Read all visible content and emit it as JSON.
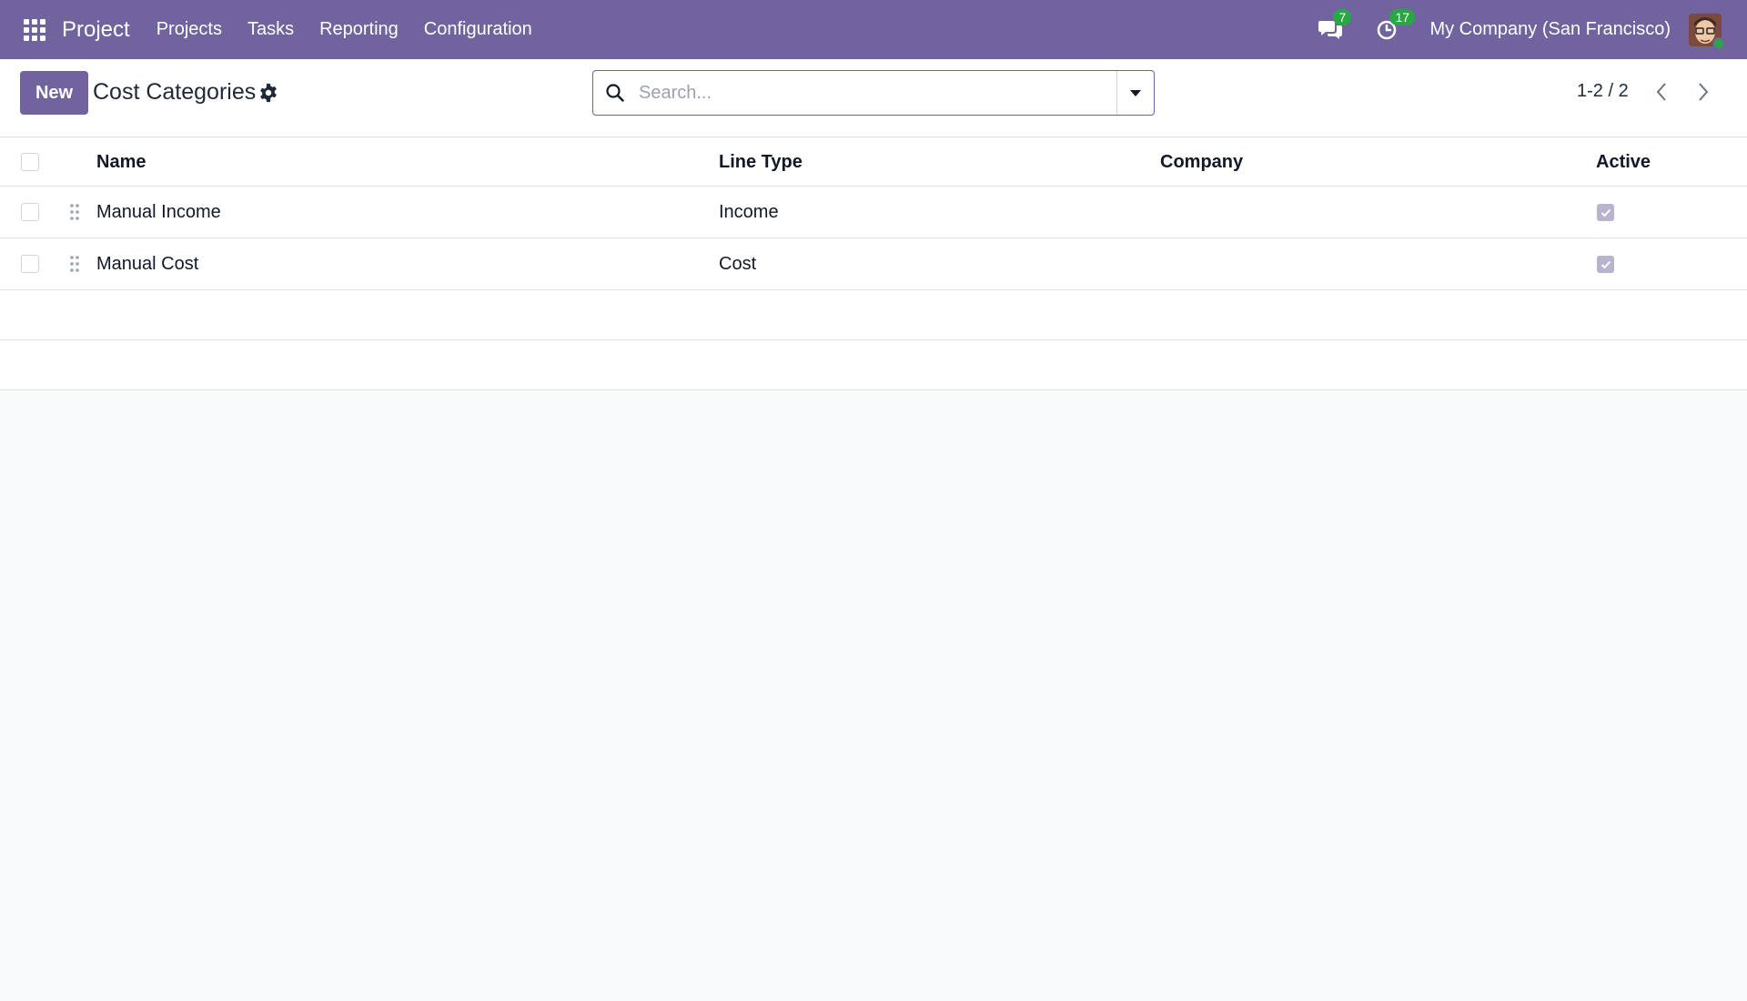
{
  "navbar": {
    "app_name": "Project",
    "menu": [
      "Projects",
      "Tasks",
      "Reporting",
      "Configuration"
    ],
    "messages_count": "7",
    "activities_count": "17",
    "company": "My Company (San Francisco)",
    "icons": [
      "apps-grid-icon",
      "chat-icon",
      "clock-icon",
      "user-avatar"
    ]
  },
  "control_panel": {
    "new_label": "New",
    "title": "Cost Categories",
    "search_placeholder": "Search...",
    "pager": "1-2 / 2"
  },
  "table": {
    "columns": [
      "Name",
      "Line Type",
      "Company",
      "Active"
    ],
    "rows": [
      {
        "name": "Manual Income",
        "line_type": "Income",
        "company": "",
        "active": true
      },
      {
        "name": "Manual Cost",
        "line_type": "Cost",
        "company": "",
        "active": true
      }
    ]
  },
  "colors": {
    "brand": "#71639e",
    "badge": "#28a745",
    "background": "#f9fafb"
  }
}
